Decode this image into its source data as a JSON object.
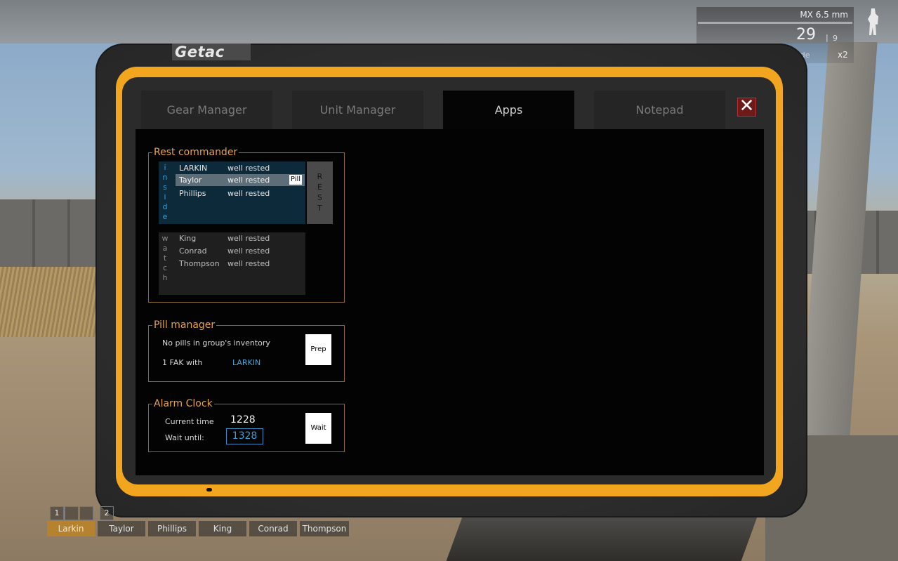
{
  "tablet": {
    "brand": "Getac",
    "tabs": [
      "Gear Manager",
      "Unit Manager",
      "Apps",
      "Notepad"
    ],
    "active_tab": "Apps",
    "close_glyph": "✕"
  },
  "rest_commander": {
    "title": "Rest commander",
    "inside_label": [
      "i",
      "n",
      "s",
      "i",
      "d",
      "e"
    ],
    "watch_label": [
      "w",
      "a",
      "t",
      "c",
      "h"
    ],
    "inside": [
      {
        "name": "LARKIN",
        "status": "well rested"
      },
      {
        "name": "Taylor",
        "status": "well rested",
        "selected": true
      },
      {
        "name": "Phillips",
        "status": "well rested"
      }
    ],
    "watch": [
      {
        "name": "King",
        "status": "well rested"
      },
      {
        "name": "Conrad",
        "status": "well rested"
      },
      {
        "name": "Thompson",
        "status": "well rested"
      }
    ],
    "pill_button": "Pill",
    "rest_button": [
      "R",
      "E",
      "S",
      "T"
    ]
  },
  "pill_manager": {
    "title": "Pill manager",
    "status": "No pills in group's inventory",
    "fak_text": "1 FAK with",
    "fak_owner": "LARKIN",
    "prep_button": "Prep"
  },
  "alarm_clock": {
    "title": "Alarm Clock",
    "current_label": "Current time",
    "current_value": "1228",
    "wait_label": "Wait until:",
    "wait_value": "1328",
    "wait_button": "Wait"
  },
  "hud": {
    "weapon": "MX 6.5 mm",
    "ammo": "29",
    "mags": "9",
    "grenade": "nade",
    "grenade_count": "x2"
  },
  "squad": {
    "slots": [
      "1",
      "2"
    ],
    "members": [
      "Larkin",
      "Taylor",
      "Phillips",
      "King",
      "Conrad",
      "Thompson"
    ]
  },
  "colors": {
    "accent": "#e5a34a",
    "link": "#4aa6d6",
    "bezel": "#f2a51f"
  }
}
